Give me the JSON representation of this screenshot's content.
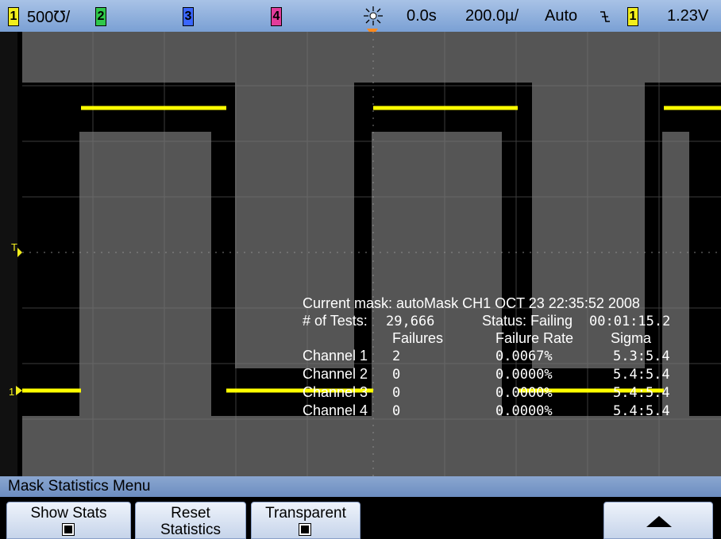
{
  "topbar": {
    "ch1_num": "1",
    "ch1_scale": "500℧/",
    "ch2_num": "2",
    "ch3_num": "3",
    "ch4_num": "4",
    "time_delay": "0.0s",
    "time_scale": "200.0µ/",
    "trigger_mode": "Auto",
    "trigger_slope_icon": "falling-edge-icon",
    "trigger_source": "1",
    "trigger_level": "1.23V",
    "colors": {
      "ch1": "#f2ee1c",
      "ch2": "#2fc84a",
      "ch3": "#3a66ff",
      "ch4": "#e23c9a"
    }
  },
  "screen": {
    "left_markers": {
      "trigger_level": "T",
      "ground": "1"
    },
    "trace_color": "#ffff00"
  },
  "stats": {
    "current_mask": "Current mask: autoMask CH1 OCT 23 22:35:52 2008",
    "tests_label": "# of Tests:",
    "tests_value": "29,666",
    "status_label": "Status: Failing",
    "elapsed": "00:01:15.2",
    "headers": {
      "failures": "Failures",
      "failure_rate": "Failure Rate",
      "sigma": "Sigma"
    },
    "rows": [
      {
        "channel": "Channel 1",
        "failures": "2",
        "rate": "0.0067%",
        "sigma": "5.3:5.4"
      },
      {
        "channel": "Channel 2",
        "failures": "0",
        "rate": "0.0000%",
        "sigma": "5.4:5.4"
      },
      {
        "channel": "Channel 3",
        "failures": "0",
        "rate": "0.0000%",
        "sigma": "5.4:5.4"
      },
      {
        "channel": "Channel 4",
        "failures": "0",
        "rate": "0.0000%",
        "sigma": "5.4:5.4"
      }
    ]
  },
  "menu": {
    "title": "Mask Statistics Menu",
    "softkeys": [
      {
        "line1": "Show Stats",
        "line2": "",
        "checkbox": true
      },
      {
        "line1": "Reset",
        "line2": "Statistics",
        "checkbox": false
      },
      {
        "line1": "Transparent",
        "line2": "",
        "checkbox": true
      },
      {
        "icon": "up-arrow-icon"
      }
    ]
  }
}
